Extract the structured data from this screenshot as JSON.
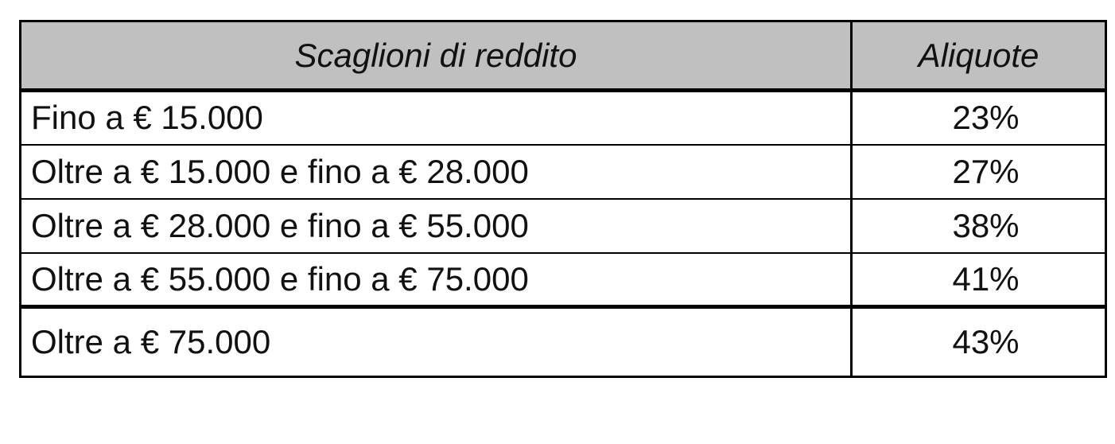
{
  "table": {
    "headers": {
      "bracket": "Scaglioni di reddito",
      "rate": "Aliquote"
    },
    "rows": [
      {
        "bracket": "Fino a  € 15.000",
        "rate": "23%"
      },
      {
        "bracket": "Oltre a € 15.000 e fino a € 28.000",
        "rate": "27%"
      },
      {
        "bracket": "Oltre a € 28.000 e fino a € 55.000",
        "rate": "38%"
      },
      {
        "bracket": "Oltre a € 55.000 e fino a € 75.000",
        "rate": "41%"
      },
      {
        "bracket": "Oltre a € 75.000",
        "rate": "43%"
      }
    ]
  },
  "colors": {
    "header_background": "#c0c0c0",
    "border": "#000000",
    "text": "#111111"
  }
}
